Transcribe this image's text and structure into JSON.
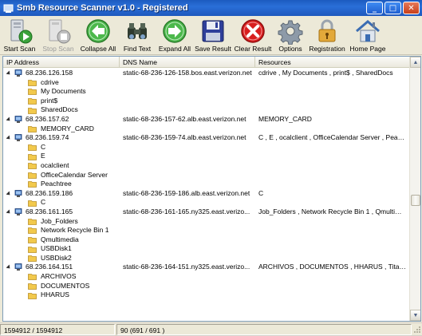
{
  "window": {
    "title": "Smb Resource Scanner v1.0 - Registered",
    "min": "_",
    "max": "□",
    "close": "✕"
  },
  "toolbar": [
    {
      "label": "Start Scan",
      "icon": "start-scan-icon",
      "enabled": true
    },
    {
      "label": "Stop Scan",
      "icon": "stop-scan-icon",
      "enabled": false
    },
    {
      "label": "Collapse All",
      "icon": "collapse-all-icon",
      "enabled": true
    },
    {
      "label": "Find Text",
      "icon": "find-text-binoculars-icon",
      "enabled": true
    },
    {
      "label": "Expand All",
      "icon": "expand-all-icon",
      "enabled": true
    },
    {
      "label": "Save Result",
      "icon": "save-result-floppy-icon",
      "enabled": true
    },
    {
      "label": "Clear Result",
      "icon": "clear-result-icon",
      "enabled": true
    },
    {
      "label": "Options",
      "icon": "options-gear-icon",
      "enabled": true
    },
    {
      "label": "Registration",
      "icon": "registration-lock-icon",
      "enabled": true
    },
    {
      "label": "Home Page",
      "icon": "home-page-icon",
      "enabled": true
    }
  ],
  "columns": {
    "ip": "IP Address",
    "dns": "DNS Name",
    "resources": "Resources"
  },
  "rows": [
    {
      "type": "host",
      "ip": "68.236.126.158",
      "dns": "static-68-236-126-158.bos.east.verizon.net",
      "resources": "cdrive , My Documents , print$ , SharedDocs"
    },
    {
      "type": "share",
      "name": "cdrive"
    },
    {
      "type": "share",
      "name": "My Documents"
    },
    {
      "type": "share",
      "name": "print$"
    },
    {
      "type": "share",
      "name": "SharedDocs"
    },
    {
      "type": "host",
      "ip": "68.236.157.62",
      "dns": "static-68-236-157-62.alb.east.verizon.net",
      "resources": "MEMORY_CARD"
    },
    {
      "type": "share",
      "name": "MEMORY_CARD"
    },
    {
      "type": "host",
      "ip": "68.236.159.74",
      "dns": "static-68-236-159-74.alb.east.verizon.net",
      "resources": "C , E , ocalclient , OfficeCalendar Server , Peach..."
    },
    {
      "type": "share",
      "name": "C"
    },
    {
      "type": "share",
      "name": "E"
    },
    {
      "type": "share",
      "name": "ocalclient"
    },
    {
      "type": "share",
      "name": "OfficeCalendar Server"
    },
    {
      "type": "share",
      "name": "Peachtree"
    },
    {
      "type": "host",
      "ip": "68.236.159.186",
      "dns": "static-68-236-159-186.alb.east.verizon.net",
      "resources": "C"
    },
    {
      "type": "share",
      "name": "C"
    },
    {
      "type": "host",
      "ip": "68.236.161.165",
      "dns": "static-68-236-161-165.ny325.east.verizo...",
      "resources": "Job_Folders , Network Recycle Bin 1 , Qmultimedi..."
    },
    {
      "type": "share",
      "name": "Job_Folders"
    },
    {
      "type": "share",
      "name": "Network Recycle Bin 1"
    },
    {
      "type": "share",
      "name": "Qmultimedia"
    },
    {
      "type": "share",
      "name": "USBDisk1"
    },
    {
      "type": "share",
      "name": "USBDisk2"
    },
    {
      "type": "host",
      "ip": "68.236.164.151",
      "dns": "static-68-236-164-151.ny325.east.verizo...",
      "resources": "ARCHIVOS , DOCUMENTOS , HHARUS , Titanio"
    },
    {
      "type": "share",
      "name": "ARCHIVOS"
    },
    {
      "type": "share",
      "name": "DOCUMENTOS"
    },
    {
      "type": "share",
      "name": "HHARUS"
    }
  ],
  "status": {
    "progress": "1594912 / 1594912",
    "count": "90 (691 / 691 )"
  },
  "colors": {
    "titlebar": "#1d58bd",
    "folder": "#f2c94c",
    "accent_green": "#3aa23a",
    "accent_red": "#d81e1e"
  }
}
